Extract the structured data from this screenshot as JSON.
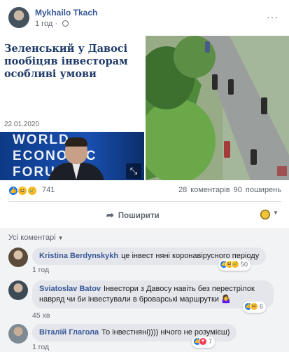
{
  "post": {
    "author": "Mykhailo Tkach",
    "time": "1 год",
    "more": "···"
  },
  "news_card": {
    "title": "Зеленський у Давосі пообіцяв інвесторам особливі умови",
    "date": "22.01.2020",
    "logo_lines": [
      "WORLD",
      "ECONOMIC",
      "FORUM"
    ]
  },
  "stats": {
    "reactions_count": "741",
    "reaction_icons": [
      "like",
      "haha",
      "sad"
    ],
    "comments": "28 коментарів",
    "shares": "90 поширень"
  },
  "actions": {
    "share_label": "Поширити",
    "share_icon": "share-arrow-icon"
  },
  "comments_section": {
    "sort_label": "Усі коментарі",
    "items": [
      {
        "name": "Kristina Berdynskykh",
        "text": "це інвест няні коронавірусного періоду",
        "time": "1 год",
        "reactions": [
          "like",
          "haha",
          "sad"
        ],
        "count": "50"
      },
      {
        "name": "Sviatoslav Batov",
        "text": "Інвестори з Давосу навіть без перестрілок навряд чи би інвестували в броварські маршрутки 🤷‍♀️",
        "time": "45 хв",
        "reactions": [
          "like",
          "haha"
        ],
        "count": "6"
      },
      {
        "name": "Віталій Глагола",
        "text": "То інвестняні)))) нічого не розумієш)",
        "time": "1 год",
        "reactions": [
          "like",
          "love"
        ],
        "count": "7"
      }
    ]
  },
  "colors": {
    "link": "#385898",
    "like": "#1877f2",
    "haha": "#f7b928",
    "love": "#f33e58",
    "comment_bubble": "#e4e6eb"
  }
}
